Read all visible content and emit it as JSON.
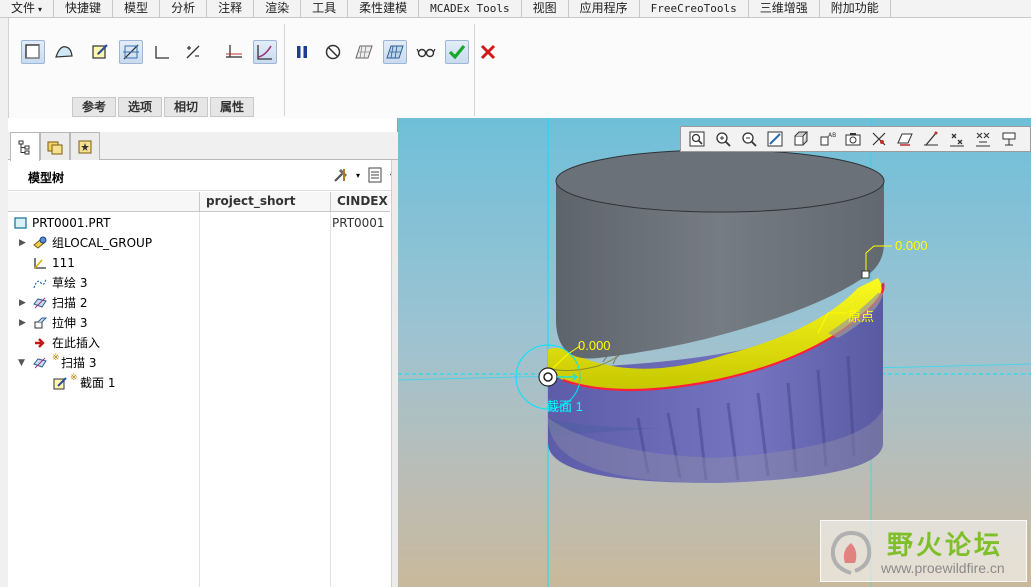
{
  "menubar": {
    "items": [
      {
        "label": "文件",
        "caret": "▾"
      },
      {
        "label": "快捷键"
      },
      {
        "label": "模型"
      },
      {
        "label": "分析"
      },
      {
        "label": "注释"
      },
      {
        "label": "渲染"
      },
      {
        "label": "工具"
      },
      {
        "label": "柔性建模"
      },
      {
        "label": "MCADEx Tools"
      },
      {
        "label": "视图"
      },
      {
        "label": "应用程序"
      },
      {
        "label": "FreeCreoTools"
      },
      {
        "label": "三维增强"
      },
      {
        "label": "附加功能"
      }
    ]
  },
  "ribbon": {
    "tabs": [
      "参考",
      "选项",
      "相切",
      "属性"
    ]
  },
  "model_tree": {
    "title": "模型树",
    "columns": [
      "project_short",
      "CINDEX"
    ],
    "rows": [
      {
        "label": "PRT0001.PRT",
        "cindex": "PRT0001"
      },
      {
        "label": "组LOCAL_GROUP",
        "expander": "▶"
      },
      {
        "label": "111"
      },
      {
        "label": "草绘 3"
      },
      {
        "label": "扫描 2",
        "expander": "▶"
      },
      {
        "label": "拉伸 3",
        "expander": "▶"
      },
      {
        "label": "在此插入"
      },
      {
        "label": "扫描 3",
        "expander": "▼"
      },
      {
        "label": "截面 1"
      }
    ]
  },
  "viewport": {
    "dimensions": [
      "0.000",
      "0.000"
    ],
    "origin_label": "原点",
    "section_label": "截面 1"
  },
  "watermark": {
    "title": "野火论坛",
    "url": "www.proewildfire.cn"
  },
  "colors": {
    "yellow_surface": "#f2f200",
    "purple_surface": "#6a6ab4",
    "gray_surface": "#6f757c",
    "edge_red": "#ff1e3c",
    "cyan_datum": "#00e5ff",
    "accept_green": "#19a829",
    "cancel_red": "#d01919"
  }
}
